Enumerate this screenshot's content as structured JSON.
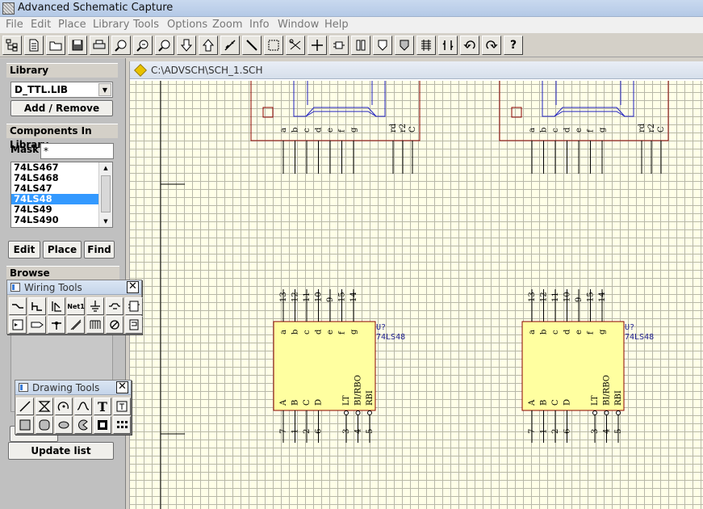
{
  "window": {
    "title": "Advanced Schematic Capture",
    "ghost_title": ""
  },
  "menu": [
    "File",
    "Edit",
    "Place",
    "Library",
    "Tools",
    "Options",
    "Zoom",
    "Info",
    "Window",
    "Help"
  ],
  "toolbar_icons": [
    "hierarchy-icon",
    "new-document-icon",
    "open-folder-icon",
    "save-icon",
    "print-icon",
    "zoom-in-icon",
    "zoom-out-icon",
    "zoom-fit-icon",
    "move-down-icon",
    "move-up-icon",
    "cut-wire-icon",
    "draw-line-icon",
    "select-area-icon",
    "scissors-icon",
    "crosshair-icon",
    "component-icon",
    "library-icon",
    "shield-icon",
    "shield-edit-icon",
    "netlist-icon",
    "swap-icon",
    "undo-icon",
    "redo-icon",
    "help-icon"
  ],
  "toolbar_help_label": "?",
  "library": {
    "header": "Library",
    "selected_library": "D_TTL.LIB",
    "add_remove_label": "Add / Remove"
  },
  "components": {
    "header": "Components In Library",
    "mask_label": "Mask",
    "mask_value": "*",
    "items": [
      "74LS467",
      "74LS468",
      "74LS47",
      "74LS48",
      "74LS49",
      "74LS490"
    ],
    "selected": "74LS48",
    "edit_label": "Edit",
    "place_label": "Place",
    "find_label": "Find"
  },
  "browse": {
    "header": "Browse",
    "update_label": "Update list"
  },
  "wiring_tools": {
    "title": "Wiring Tools",
    "close": "✕",
    "net_label": "Net1",
    "icons": [
      "wire-icon",
      "bus-icon",
      "bus-entry-icon",
      "net-label-icon",
      "power-port-icon",
      "part-icon",
      "sheet-symbol-icon",
      "sheet-entry-icon",
      "port-icon",
      "junction-icon",
      "directive-icon",
      "harness-icon",
      "no-erc-icon",
      "probe-icon"
    ]
  },
  "drawing_tools": {
    "title": "Drawing Tools",
    "close": "✕",
    "text_glyph": "T",
    "icons": [
      "line-icon",
      "polygon-icon",
      "arc-icon",
      "bezier-icon",
      "text-icon",
      "text-frame-icon",
      "rectangle-icon",
      "rounded-rectangle-icon",
      "ellipse-icon",
      "pie-icon",
      "graphic-icon",
      "array-icon"
    ]
  },
  "document": {
    "path": "C:\\ADVSCH\\SCH_1.SCH"
  },
  "schematic": {
    "top_pins": [
      "a",
      "b",
      "c",
      "d",
      "e",
      "f",
      "g"
    ],
    "top_extra_pins": [
      "rd",
      "r2",
      "C"
    ],
    "chip_designator": "U?",
    "chip_part": "74LS48",
    "chip_inputs_top": [
      "13",
      "12",
      "11",
      "10",
      "9",
      "15",
      "14"
    ],
    "chip_pins_top": [
      "a",
      "b",
      "c",
      "d",
      "e",
      "f",
      "g"
    ],
    "chip_pins_bottom": [
      "A",
      "B",
      "C",
      "D",
      "LT",
      "BI/RBO",
      "RBI"
    ],
    "chip_inputs_bottom": [
      "7",
      "1",
      "2",
      "6",
      "3",
      "4",
      "5"
    ]
  }
}
